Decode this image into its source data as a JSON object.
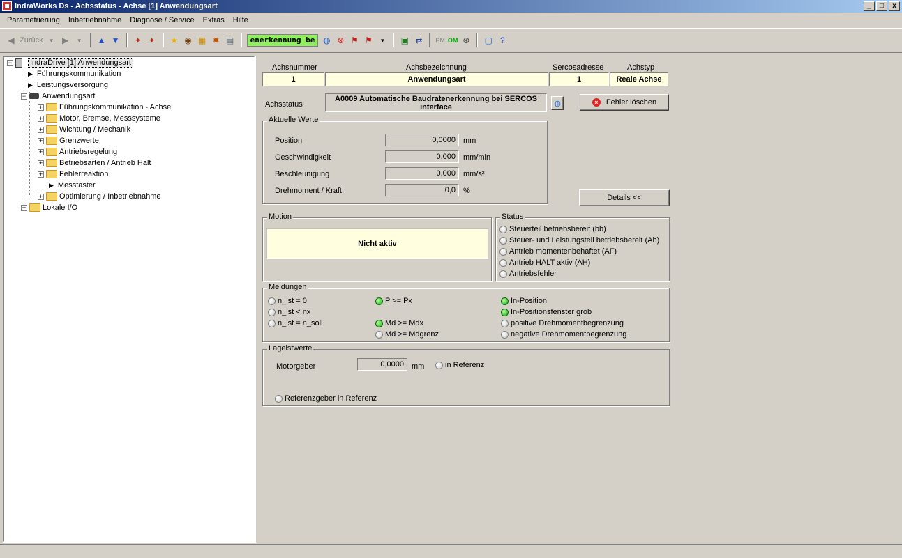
{
  "window": {
    "title": "IndraWorks Ds - Achsstatus - Achse [1] Anwendungsart",
    "controls": [
      "_",
      "□",
      "x"
    ]
  },
  "menu": [
    "Parametrierung",
    "Inbetriebnahme",
    "Diagnose / Service",
    "Extras",
    "Hilfe"
  ],
  "toolbar": {
    "back_label": "Zurück",
    "status_field": "enerkennung be",
    "pm_label": "PM",
    "om_label": "OM"
  },
  "tree": {
    "root": "IndraDrive [1] Anwendungsart",
    "items": [
      "Führungskommunikation",
      "Leistungsversorgung",
      "Anwendungsart",
      "Führungskommunikation - Achse",
      "Motor, Bremse, Messsysteme",
      "Wichtung / Mechanik",
      "Grenzwerte",
      "Antriebsregelung",
      "Betriebsarten / Antrieb Halt",
      "Fehlerreaktion",
      "Messtaster",
      "Optimierung / Inbetriebnahme",
      "Lokale I/O"
    ]
  },
  "axis": {
    "headers": {
      "achsnummer": "Achsnummer",
      "achsbezeichnung": "Achsbezeichnung",
      "sercosadresse": "Sercosadresse",
      "achstyp": "Achstyp"
    },
    "values": {
      "achsnummer": "1",
      "achsbezeichnung": "Anwendungsart",
      "sercosadresse": "1",
      "achstyp": "Reale Achse"
    },
    "status_label": "Achsstatus",
    "status_text": "A0009 Automatische Baudratenerkennung bei SERCOS interface",
    "clear_error_button": "Fehler löschen"
  },
  "actual_values": {
    "title": "Aktuelle Werte",
    "rows": [
      {
        "label": "Position",
        "value": "0,0000",
        "unit": "mm"
      },
      {
        "label": "Geschwindigkeit",
        "value": "0,000",
        "unit": "mm/min"
      },
      {
        "label": "Beschleunigung",
        "value": "0,000",
        "unit": "mm/s²"
      },
      {
        "label": "Drehmoment / Kraft",
        "value": "0,0",
        "unit": "%"
      }
    ],
    "details_button": "Details <<"
  },
  "motion": {
    "title": "Motion",
    "state": "Nicht aktiv"
  },
  "status": {
    "title": "Status",
    "items": [
      "Steuerteil betriebsbereit (bb)",
      "Steuer- und Leistungsteil betriebsbereit (Ab)",
      "Antrieb momentenbehaftet (AF)",
      "Antrieb HALT aktiv (AH)",
      "Antriebsfehler"
    ]
  },
  "messages": {
    "title": "Meldungen",
    "col1": [
      "n_ist = 0",
      "n_ist < nx",
      "n_ist = n_soll"
    ],
    "col2": [
      "P >= Px",
      "Md >= Mdx",
      "Md >= Mdgrenz"
    ],
    "col3": [
      "In-Position",
      "In-Positionsfenster grob",
      "positive Drehmomentbegrenzung",
      "negative Drehmomentbegrenzung"
    ]
  },
  "position_values": {
    "title": "Lageistwerte",
    "encoder_label": "Motorgeber",
    "encoder_value": "0,0000",
    "encoder_unit": "mm",
    "in_reference": "in Referenz",
    "ref_encoder": "Referenzgeber in Referenz"
  }
}
